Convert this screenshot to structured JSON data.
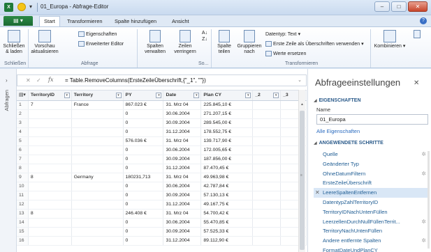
{
  "window": {
    "title": "01_Europa - Abfrage-Editor",
    "app_icon": "X",
    "buttons": [
      "minimize",
      "maximize",
      "close"
    ]
  },
  "ribbon_tabs": {
    "file_label": "▤ ▾",
    "tabs": [
      "Start",
      "Transformieren",
      "Spalte hinzufügen",
      "Ansicht"
    ]
  },
  "ribbon": {
    "close_load": "Schließen & laden",
    "refresh_preview": "Vorschau aktualisieren",
    "properties": "Eigenschaften",
    "advanced_editor": "Erweiterter Editor",
    "manage_columns": "Spalten verwalten",
    "reduce_rows": "Zeilen verringern",
    "split_column": "Spalte teilen",
    "group_by": "Gruppieren nach",
    "data_type": "Datentyp: Text",
    "first_row_headers": "Erste Zeile als Überschriften verwenden",
    "replace_values": "Werte ersetzen",
    "combine": "Kombinieren",
    "group_close": "Schließen",
    "group_query": "Abfrage",
    "group_so": "So...",
    "group_transform": "Transformieren"
  },
  "sidebar": {
    "label": "Abfragen"
  },
  "formula": {
    "fx": "fx",
    "text": "= Table.RemoveColumns(ErsteZeileÜberschrift,{\"_1\", \"\"})"
  },
  "table": {
    "columns": [
      "TerritoryID",
      "Territory",
      "PY",
      "Date",
      "Plan CY",
      "_2",
      "_3"
    ],
    "rows": [
      [
        "1",
        "7",
        "France",
        "867.023 €",
        "31. Mrz 04",
        "225.845,10 €",
        "",
        ""
      ],
      [
        "2",
        "",
        "",
        "0",
        "30.06.2004",
        "271.207,15 €",
        "",
        ""
      ],
      [
        "3",
        "",
        "",
        "0",
        "30.09.2004",
        "289.545,00 €",
        "",
        ""
      ],
      [
        "4",
        "",
        "",
        "0",
        "31.12.2004",
        "178.552,75 €",
        "",
        ""
      ],
      [
        "5",
        "",
        "",
        "576.036 €",
        "31. Mrz 04",
        "139.717,90 €",
        "",
        ""
      ],
      [
        "6",
        "",
        "",
        "0",
        "30.06.2004",
        "172.005,65 €",
        "",
        ""
      ],
      [
        "7",
        "",
        "",
        "0",
        "30.09.2004",
        "187.856,00 €",
        "",
        ""
      ],
      [
        "8",
        "",
        "",
        "0",
        "31.12.2004",
        "87.470,45 €",
        "",
        ""
      ],
      [
        "9",
        "8",
        "Germany",
        "180231,713",
        "31. Mrz 04",
        "49.963,98 €",
        "",
        ""
      ],
      [
        "10",
        "",
        "",
        "0",
        "30.06.2004",
        "42.787,84 €",
        "",
        ""
      ],
      [
        "11",
        "",
        "",
        "0",
        "30.09.2004",
        "57.130,13 €",
        "",
        ""
      ],
      [
        "12",
        "",
        "",
        "0",
        "31.12.2004",
        "49.167,75 €",
        "",
        ""
      ],
      [
        "13",
        "8",
        "",
        "246.408 €",
        "31. Mrz 04",
        "54.700,42 €",
        "",
        ""
      ],
      [
        "14",
        "",
        "",
        "0",
        "30.06.2004",
        "55.470,85 €",
        "",
        ""
      ],
      [
        "15",
        "",
        "",
        "0",
        "30.09.2004",
        "57.525,33 €",
        "",
        ""
      ],
      [
        "16",
        "",
        "",
        "0",
        "31.12.2004",
        "89.112,90 €",
        "",
        ""
      ]
    ]
  },
  "query_settings": {
    "title": "Abfrageeinstellungen",
    "properties_header": "EIGENSCHAFTEN",
    "name_label": "Name",
    "name_value": "01_Europa",
    "all_properties": "Alle Eigenschaften",
    "steps_header": "ANGEWENDETE SCHRITTE",
    "steps": [
      {
        "label": "Quelle",
        "gear": true,
        "selected": false,
        "x": false
      },
      {
        "label": "Geänderter Typ",
        "gear": false,
        "selected": false,
        "x": false
      },
      {
        "label": "OhneDatumFiltern",
        "gear": true,
        "selected": false,
        "x": false
      },
      {
        "label": "ErsteZeileÜberschrift",
        "gear": false,
        "selected": false,
        "x": false
      },
      {
        "label": "LeereSpaltenEntfernen",
        "gear": false,
        "selected": true,
        "x": true
      },
      {
        "label": "DatentypZahlTerritoryID",
        "gear": false,
        "selected": false,
        "x": false
      },
      {
        "label": "TerritoryIDNachUntenFüllen",
        "gear": false,
        "selected": false,
        "x": false
      },
      {
        "label": "LeerzellenDurchNullFüllenTerrit...",
        "gear": true,
        "selected": false,
        "x": false
      },
      {
        "label": "TerritoryNachUntenFüllen",
        "gear": false,
        "selected": false,
        "x": false
      },
      {
        "label": "Andere entfernte Spalten",
        "gear": true,
        "selected": false,
        "x": false
      },
      {
        "label": "FormatDateUndPlanCY",
        "gear": false,
        "selected": false,
        "x": false
      }
    ]
  }
}
